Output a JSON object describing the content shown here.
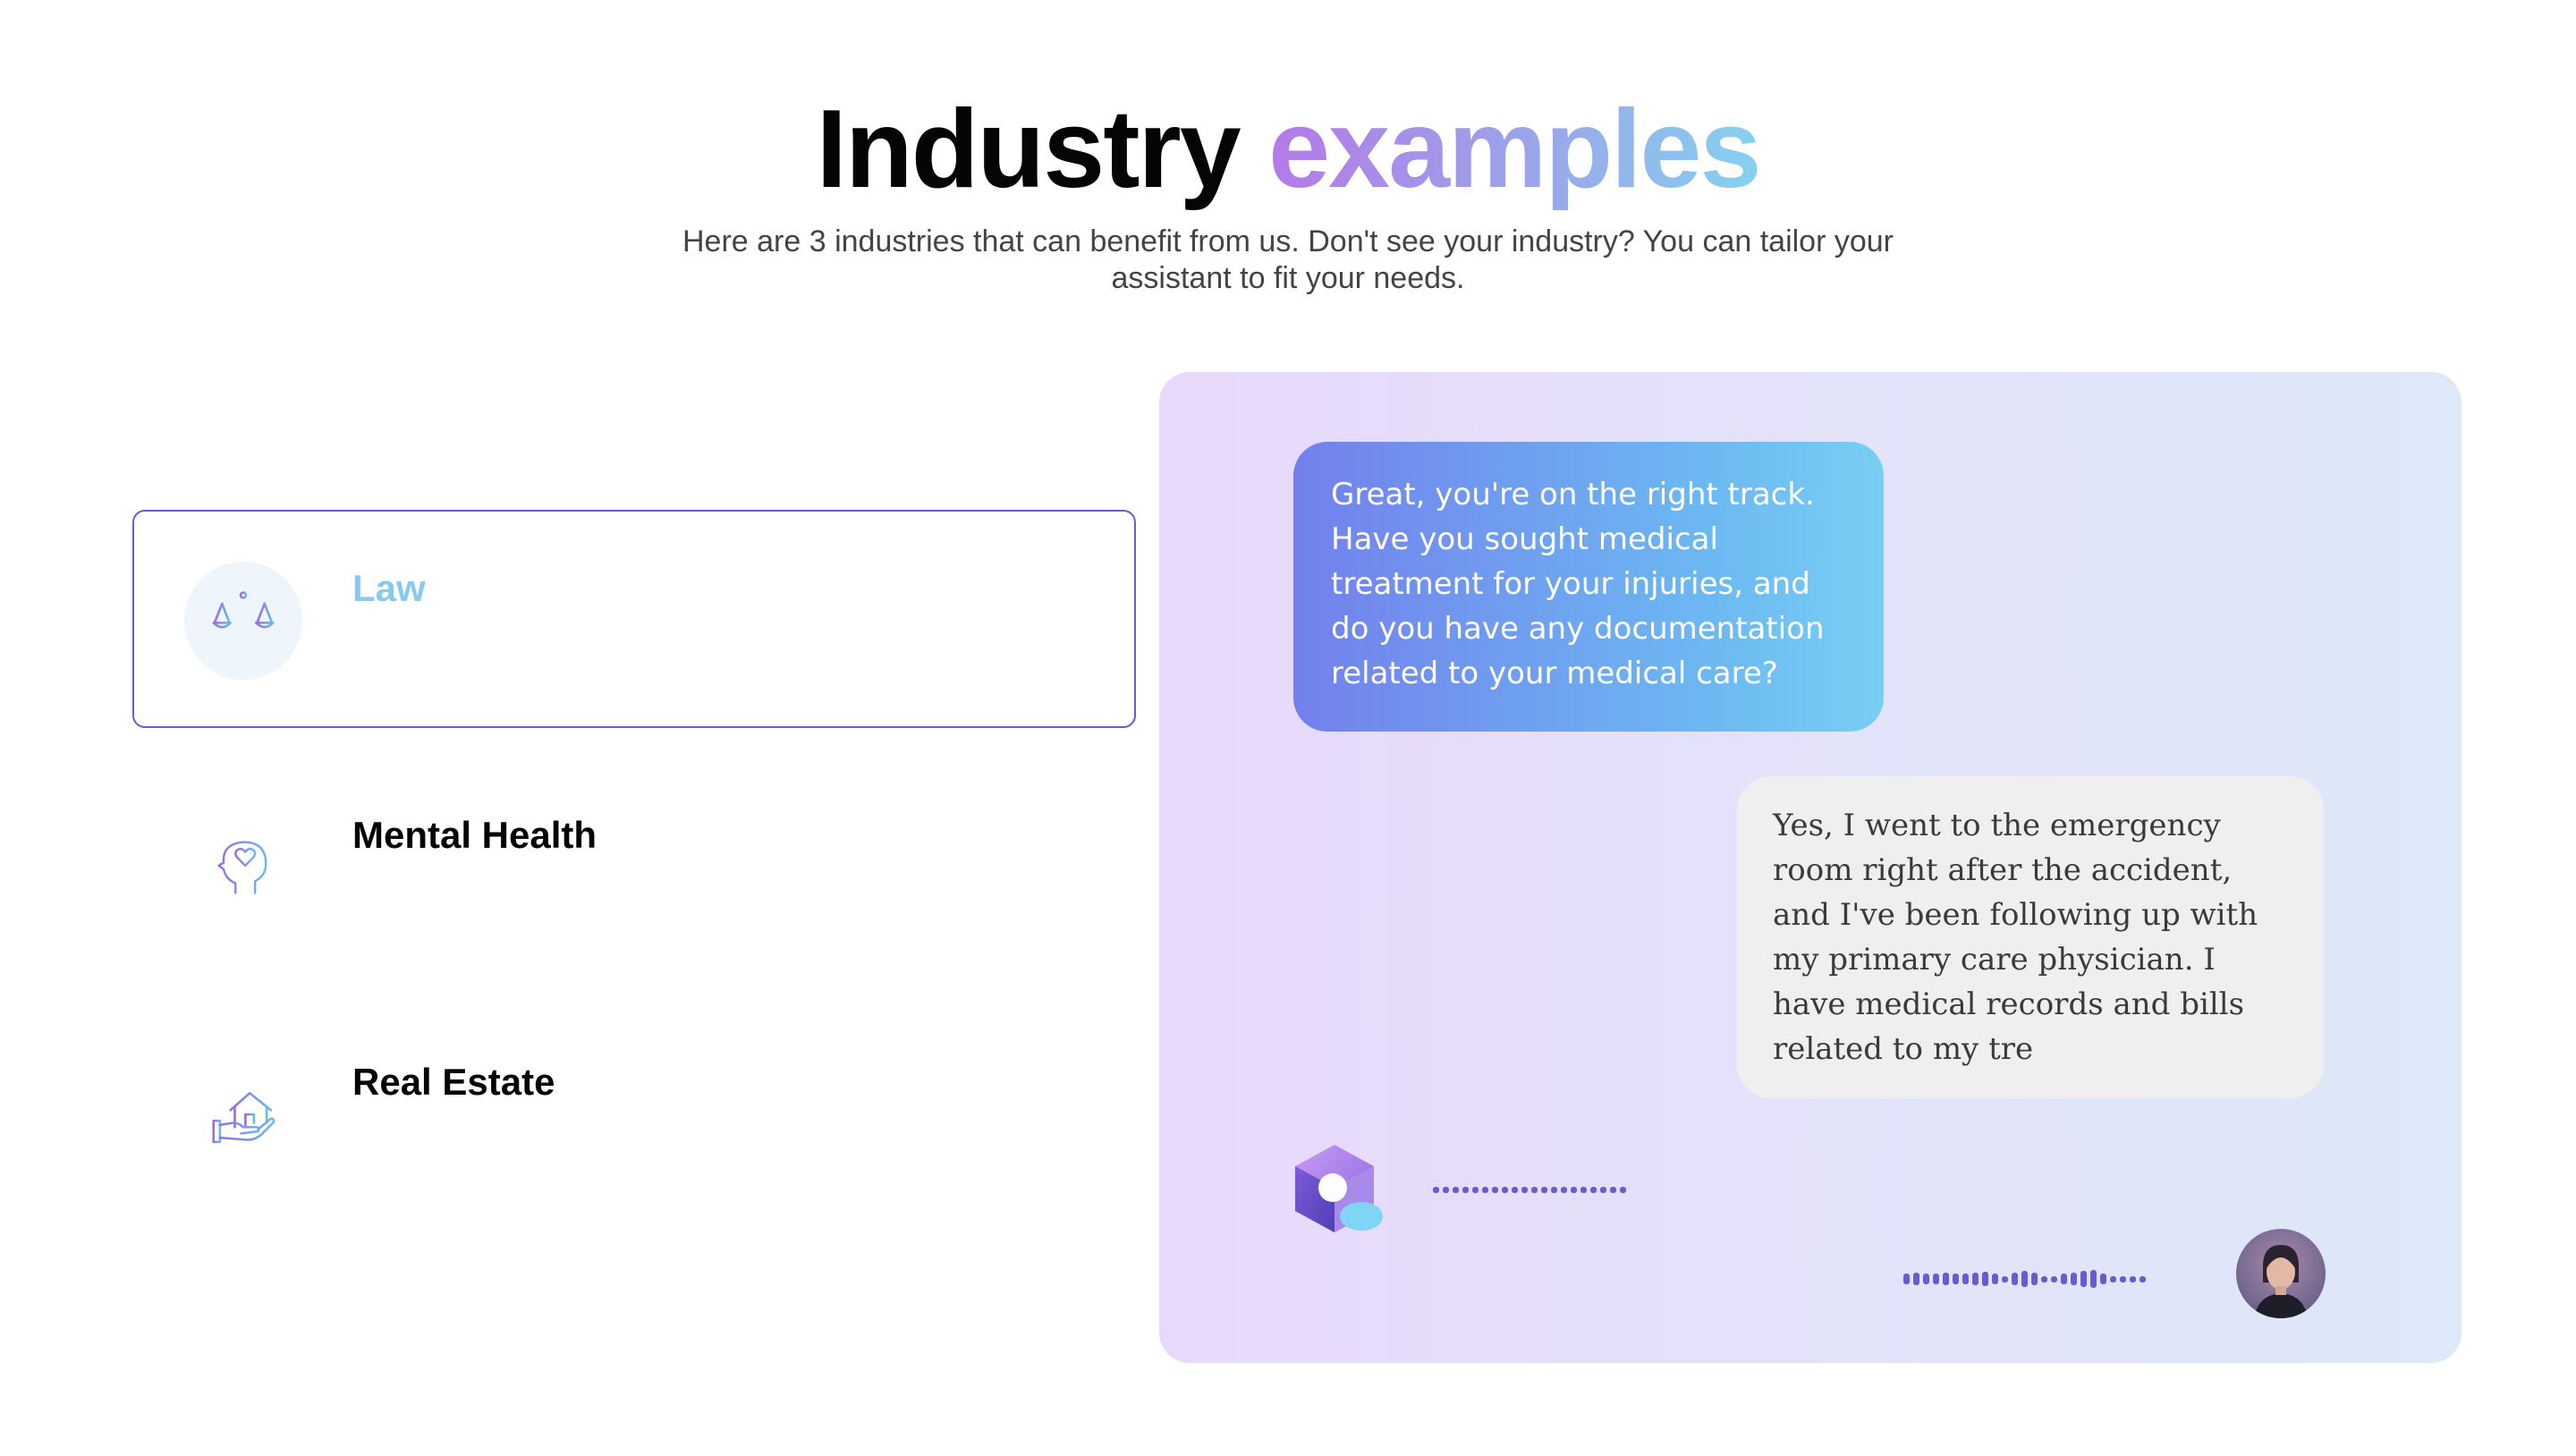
{
  "header": {
    "title_main": "Industry",
    "title_accent": "examples",
    "subtitle": "Here are 3 industries that can benefit from us. Don't see your industry? You can tailor your assistant to fit your needs."
  },
  "industries": [
    {
      "label": "Law",
      "icon": "scales-icon",
      "selected": true
    },
    {
      "label": "Mental Health",
      "icon": "head-heart-icon",
      "selected": false
    },
    {
      "label": "Real Estate",
      "icon": "house-hand-icon",
      "selected": false
    }
  ],
  "preview": {
    "bot_message": "Great, you're on the right track. Have you sought medical treatment for your injuries, and do you have any documentation related to your medical care?",
    "user_message": "Yes, I went to the emergency room right after the accident, and I've been following up with my primary care physician. I have medical records and bills related to my tre",
    "bot_avatar_icon": "assistant-logo-icon",
    "user_avatar_icon": "user-avatar",
    "bot_wave_icon": "audio-waveform-icon",
    "user_wave_icon": "audio-waveform-icon"
  },
  "colors": {
    "accent_gradient_start": "#b47ae8",
    "accent_gradient_end": "#86d1ef",
    "selected_border": "#6a5ad8",
    "selected_label": "#87caf0",
    "bot_bubble_start": "#7380ec",
    "bot_bubble_end": "#78cef4",
    "user_bubble": "#efefef",
    "waveform": "#6a5ad0"
  }
}
